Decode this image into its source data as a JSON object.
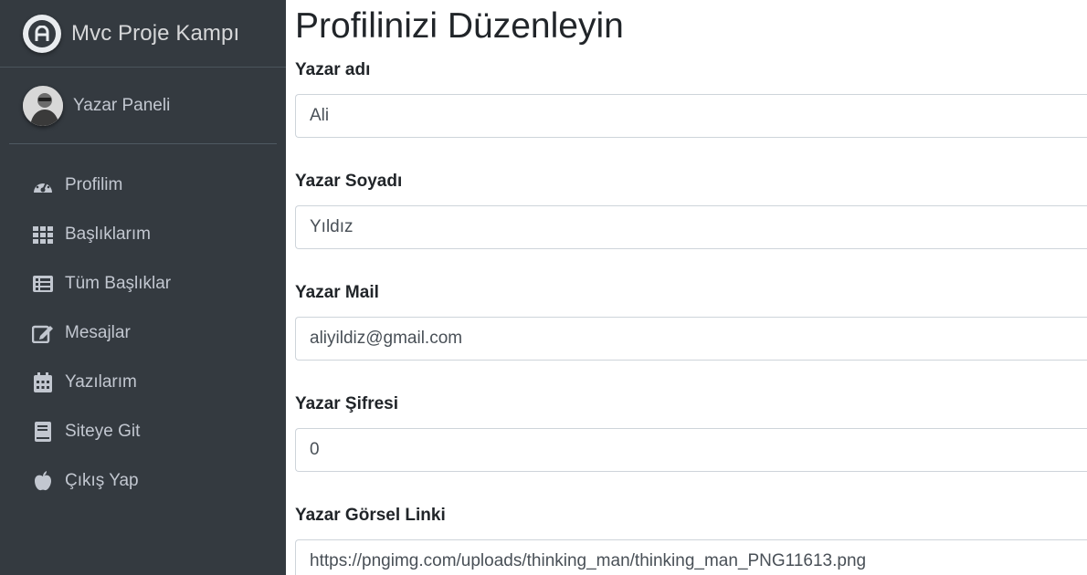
{
  "brand": {
    "name": "Mvc Proje Kampı"
  },
  "user": {
    "name": "Yazar Paneli"
  },
  "nav": [
    {
      "label": "Profilim",
      "icon": "tachometer-icon"
    },
    {
      "label": "Başlıklarım",
      "icon": "grid-icon"
    },
    {
      "label": "Tüm Başlıklar",
      "icon": "list-icon"
    },
    {
      "label": "Mesajlar",
      "icon": "edit-icon"
    },
    {
      "label": "Yazılarım",
      "icon": "calendar-icon"
    },
    {
      "label": "Siteye Git",
      "icon": "book-icon"
    },
    {
      "label": "Çıkış Yap",
      "icon": "apple-icon"
    }
  ],
  "page": {
    "title": "Profilinizi Düzenleyin",
    "fields": {
      "first_name": {
        "label": "Yazar adı",
        "value": "Ali"
      },
      "last_name": {
        "label": "Yazar Soyadı",
        "value": "Yıldız"
      },
      "mail": {
        "label": "Yazar Mail",
        "value": "aliyildiz@gmail.com"
      },
      "password": {
        "label": "Yazar Şifresi",
        "value": "0"
      },
      "image": {
        "label": "Yazar Görsel Linki",
        "value": "https://pngimg.com/uploads/thinking_man/thinking_man_PNG11613.png"
      }
    }
  }
}
